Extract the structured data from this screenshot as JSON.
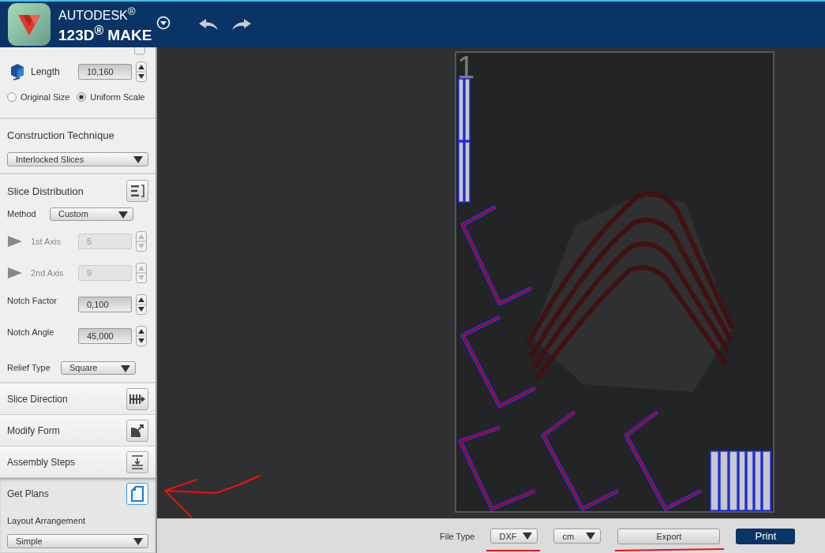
{
  "header": {
    "brand": "AUTODESK$^{®}$",
    "product": "123D$^{®}$ MAKE"
  },
  "sidebar": {
    "length": {
      "label": "Length",
      "value": "10,160"
    },
    "scale_options": [
      {
        "label": "Original Size",
        "selected": false
      },
      {
        "label": "Uniform Scale",
        "selected": true
      }
    ],
    "construction": {
      "title": "Construction Technique",
      "value": "Interlocked Slices"
    },
    "slice_distribution": {
      "title": "Slice Distribution",
      "rows": [
        {
          "kind": "dropdown",
          "label": "Method",
          "value": "Custom",
          "disabled": false
        },
        {
          "kind": "axis",
          "label": "1st Axis",
          "value": "5",
          "disabled": true
        },
        {
          "kind": "axis",
          "label": "2nd Axis",
          "value": "9",
          "disabled": true
        },
        {
          "kind": "number",
          "label": "Notch Factor",
          "value": "0,100",
          "disabled": false
        },
        {
          "kind": "number",
          "label": "Notch Angle",
          "value": "45,000",
          "disabled": false
        },
        {
          "kind": "dropdown",
          "label": "Relief Type",
          "value": "Square",
          "disabled": false
        }
      ]
    },
    "steps": [
      {
        "title": "Slice Direction",
        "selected": false
      },
      {
        "title": "Modify Form",
        "selected": false
      },
      {
        "title": "Assembly Steps",
        "selected": false
      },
      {
        "title": "Get Plans",
        "selected": true
      }
    ],
    "layout_arrangement": {
      "label": "Layout Arrangement",
      "value": "Simple"
    }
  },
  "sheet": {
    "number": "1"
  },
  "bottom_bar": {
    "file_type_label": "File Type",
    "file_type": "DXF",
    "unit": "cm",
    "export": "Export",
    "print": "Print"
  }
}
